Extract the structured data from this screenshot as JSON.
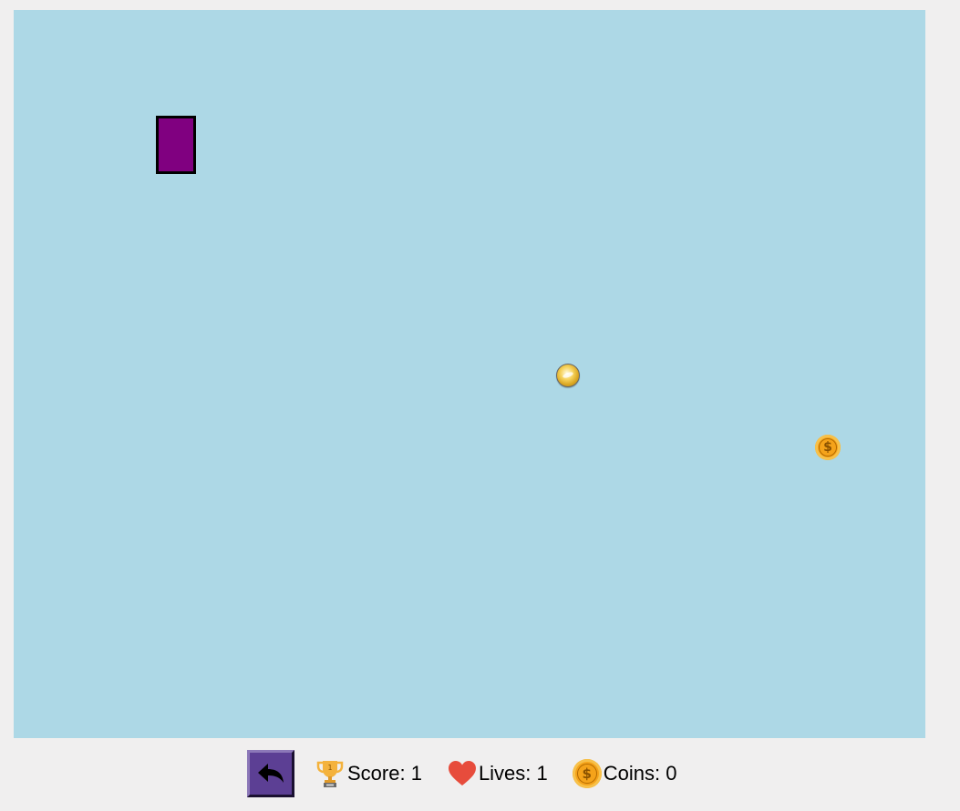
{
  "hud": {
    "back_icon": "undo-arrow-icon",
    "score_icon": "trophy-icon",
    "score_label": "Score: 1",
    "lives_icon": "heart-icon",
    "lives_label": "Lives: 1",
    "coins_icon": "coin-icon",
    "coins_label": "Coins: 0"
  },
  "game": {
    "canvas_color": "#add8e6",
    "player_color": "#800080",
    "ball_icon": "ball-icon",
    "coin_icon": "coin-icon",
    "coin_symbol": "$"
  }
}
